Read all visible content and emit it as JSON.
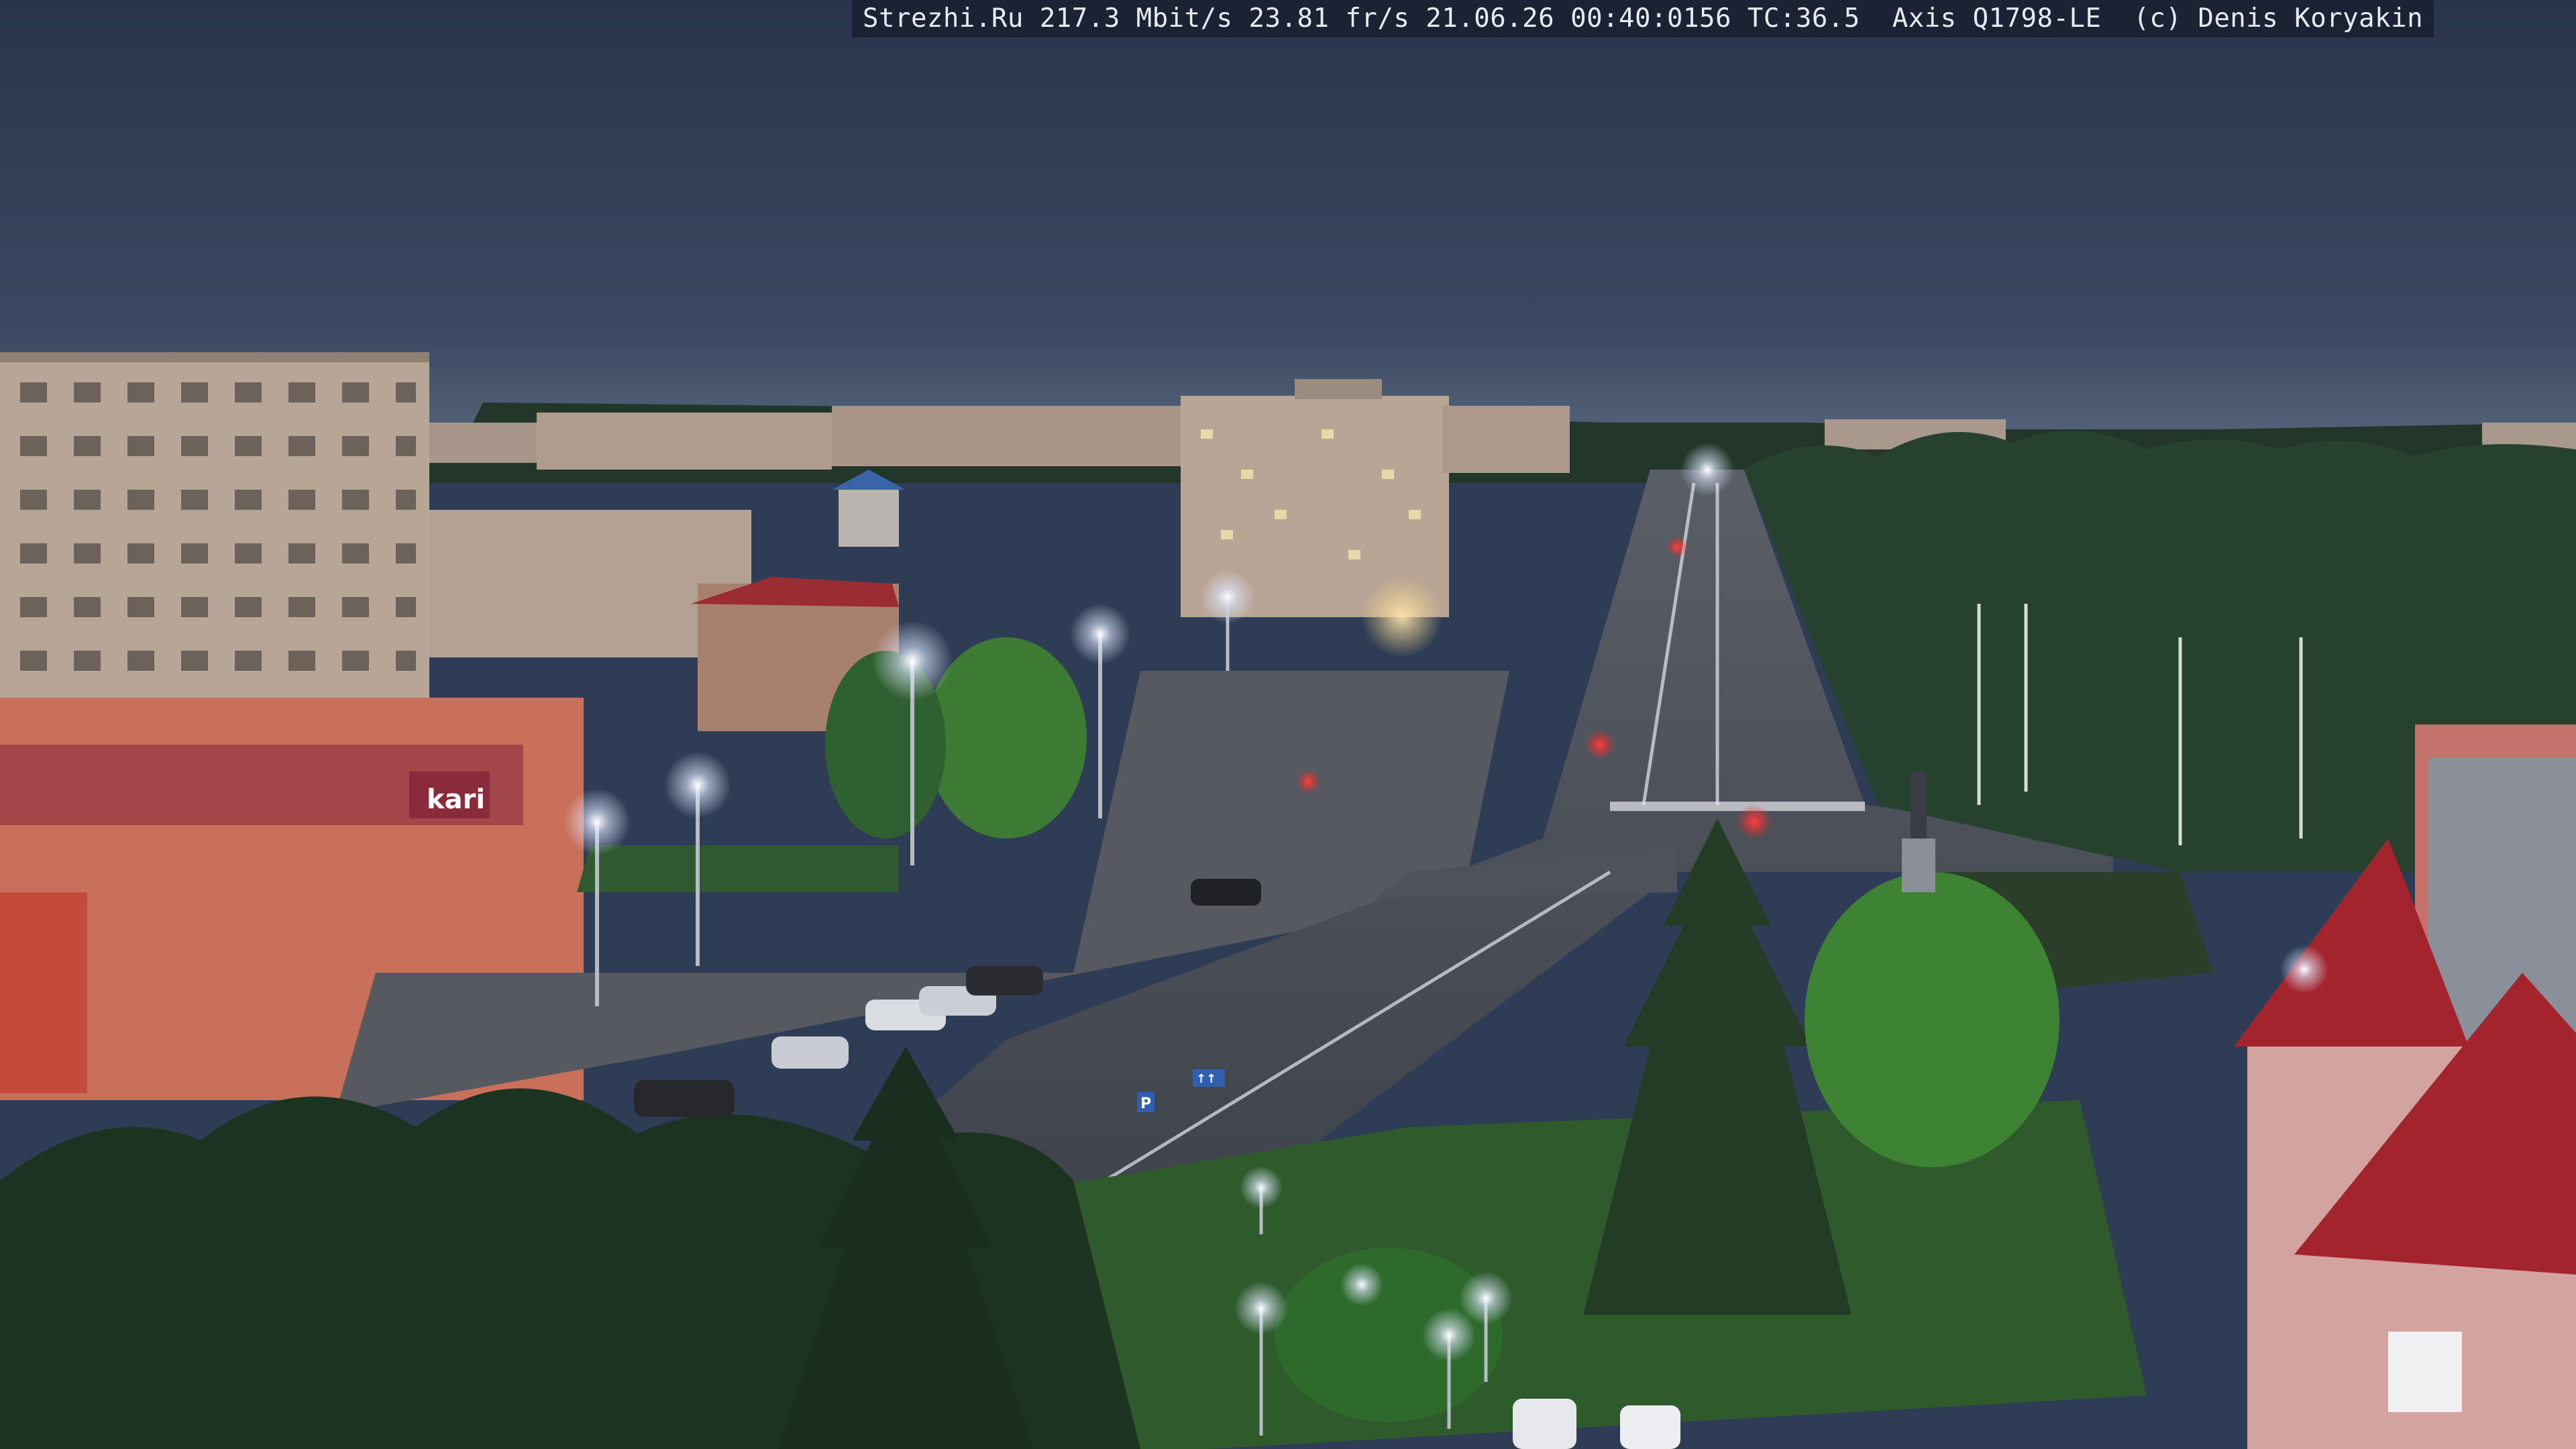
{
  "overlay": {
    "text": "Strezhi.Ru 217.3 Mbit/s 23.81 fr/s 21.06.26 00:40:0156 TC:36.5  Axis Q1798-LE  (c) Denis Koryakin"
  },
  "signs": {
    "shop_sign": "kari",
    "road_sign_p": "P",
    "road_sign_lanes": "↑↑"
  },
  "palette": {
    "sky_top": "#2a3852",
    "sky_horizon": "#58677d",
    "road": "#4b4f57",
    "trees": "#1f3526",
    "tree_lit": "#4e9b3a",
    "building": "#b8a594",
    "red_roof": "#9b2c34",
    "street_lamp": "#e9f0ff"
  }
}
